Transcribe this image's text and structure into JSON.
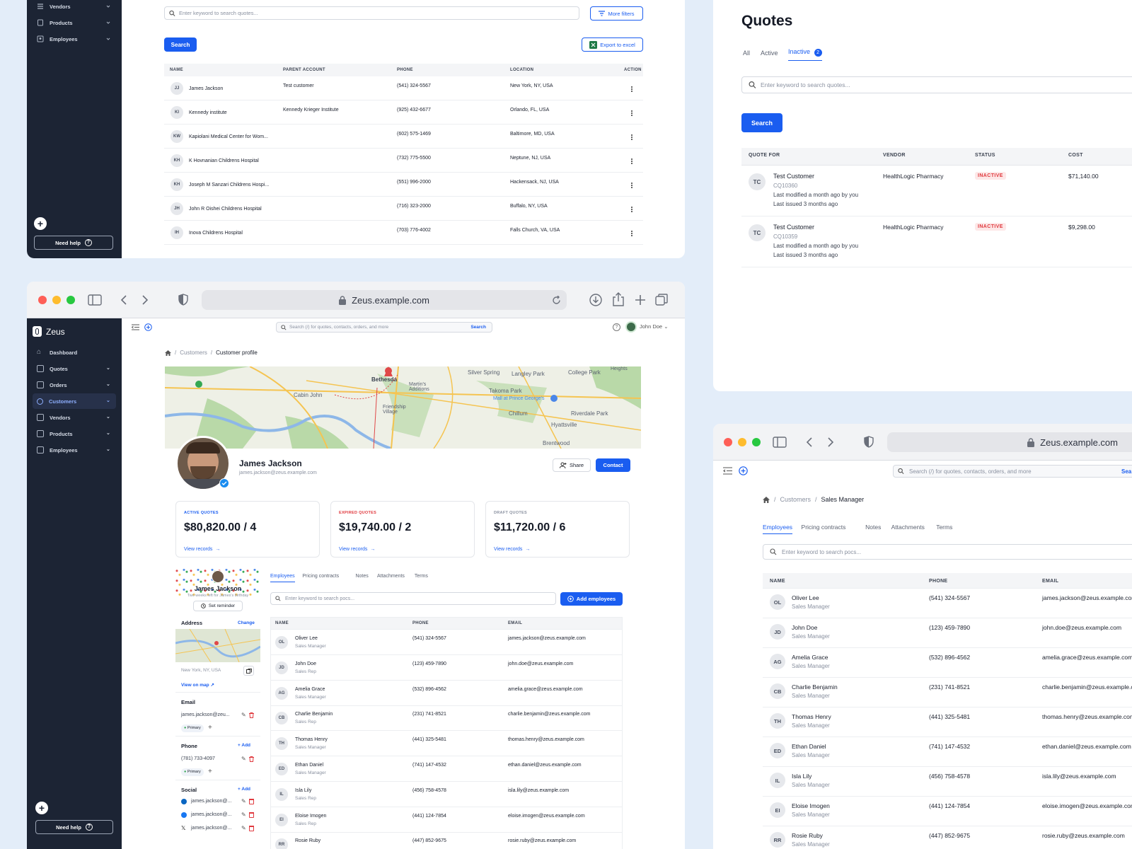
{
  "sidebar_top": {
    "items": [
      {
        "label": "Vendors"
      },
      {
        "label": "Products"
      },
      {
        "label": "Employees"
      }
    ],
    "need_help": "Need help"
  },
  "accounts_panel": {
    "search_placeholder": "Enter keyword to search quotes...",
    "more_filters": "More filters",
    "search_button": "Search",
    "export_button": "Export to excel",
    "columns": [
      "NAME",
      "PARENT ACCOUNT",
      "PHONE",
      "LOCATION",
      "ACTION"
    ],
    "rows": [
      {
        "initials": "JJ",
        "name": "James Jackson",
        "parent": "Test customer",
        "phone": "(541) 324-5567",
        "location": "New York, NY, USA"
      },
      {
        "initials": "KI",
        "name": "Kennedy institute",
        "parent": "Kennedy Krieger Institute",
        "phone": "(925) 432-6677",
        "location": "Orlando, FL, USA"
      },
      {
        "initials": "KW",
        "name": "Kapiolani Medical Center for Wom...",
        "parent": "",
        "phone": "(602) 575-1469",
        "location": "Baltimore, MD, USA"
      },
      {
        "initials": "KH",
        "name": "K Hovnanian Childrens Hospital",
        "parent": "",
        "phone": "(732) 775-5500",
        "location": "Neptune, NJ, USA"
      },
      {
        "initials": "KH",
        "name": "Joseph M Sanzari Childrens Hospi...",
        "parent": "",
        "phone": "(551) 996-2000",
        "location": "Hackensack, NJ, USA"
      },
      {
        "initials": "JH",
        "name": "John R Oishei Childrens Hospital",
        "parent": "",
        "phone": "(716) 323-2000",
        "location": "Buffalo, NY, USA"
      },
      {
        "initials": "IH",
        "name": "Inova Childrens Hospital",
        "parent": "",
        "phone": "(703) 776-4002",
        "location": "Falls Church, VA, USA"
      }
    ]
  },
  "quotes_panel": {
    "title": "Quotes",
    "tabs": [
      {
        "label": "All"
      },
      {
        "label": "Active"
      },
      {
        "label": "Inactive"
      }
    ],
    "inactive_count": "2",
    "search_placeholder": "Enter keyword to search quotes...",
    "search_button": "Search",
    "columns": [
      "QUOTE FOR",
      "VENDOR",
      "STATUS",
      "COST"
    ],
    "rows": [
      {
        "initials": "TC",
        "name": "Test Customer",
        "id": "CQ10360",
        "modified": "Last modified a month ago by you",
        "issued": "Last issued 3 months ago",
        "vendor": "HealthLogic Pharmacy",
        "status": "INACTIVE",
        "cost": "$71,140.00"
      },
      {
        "initials": "TC",
        "name": "Test Customer",
        "id": "CQ10359",
        "modified": "Last modified a month ago by you",
        "issued": "Last issued 3 months ago",
        "vendor": "HealthLogic Pharmacy",
        "status": "INACTIVE",
        "cost": "$9,298.00"
      }
    ]
  },
  "profile_window": {
    "url": "Zeus.example.com",
    "app_name": "Zeus",
    "nav": [
      {
        "label": "Dashboard"
      },
      {
        "label": "Quotes"
      },
      {
        "label": "Orders"
      },
      {
        "label": "Customers"
      },
      {
        "label": "Vendors"
      },
      {
        "label": "Products"
      },
      {
        "label": "Employees"
      }
    ],
    "need_help": "Need help",
    "global_search_placeholder": "Search (/) for quotes, contacts, orders, and more",
    "global_search_button": "Search",
    "user_name": "John Doe",
    "breadcrumb": [
      "Customers",
      "Customer profile"
    ],
    "map_labels": {
      "silver_spring": "Silver Spring",
      "langley_park": "Langley Park",
      "college_park": "College Park",
      "bethesda": "Bethesda",
      "takoma_park": "Takoma Park",
      "cabin_john": "Cabin John",
      "chillum": "Chillum",
      "riverdale_park": "Riverdale Park",
      "hyattsville": "Hyattsville",
      "friendship_village": "Friendship Village",
      "brentwood": "Brentwood",
      "mall_prince_george": "Mall at Prince George's",
      "heights": "Heights",
      "martins_additions": "Martin's Additions"
    },
    "profile_name": "James Jackson",
    "profile_email": "james.jackson@zeus.example.com",
    "share_button": "Share",
    "contact_button": "Contact",
    "stats": [
      {
        "label": "ACTIVE QUOTES",
        "value": "$80,820.00 / 4",
        "link": "View records",
        "color": "#1a5df0"
      },
      {
        "label": "EXPIRED QUOTES",
        "value": "$19,740.00 / 2",
        "link": "View records",
        "color": "#e0393e"
      },
      {
        "label": "DRAFT QUOTES",
        "value": "$11,720.00 / 6",
        "link": "View records",
        "color": "#8a91a0"
      }
    ],
    "card": {
      "name": "James Jackson",
      "birthday": "Two weeks left for James's birthday",
      "set_reminder": "Set reminder",
      "address_label": "Address",
      "change": "Change",
      "address": "New York, NY, USA",
      "view_on_map": "View on map",
      "email_label": "Email",
      "email": "james.jackson@zeu...",
      "primary": "Primary",
      "phone_label": "Phone",
      "add": "Add",
      "phone": "(781) 733-4097",
      "social_label": "Social",
      "socials": [
        "james.jackson@...",
        "james.jackson@...",
        "james.jackson@..."
      ]
    },
    "tabs": [
      {
        "label": "Employees"
      },
      {
        "label": "Pricing contracts"
      },
      {
        "label": "Notes"
      },
      {
        "label": "Attachments"
      },
      {
        "label": "Terms"
      }
    ],
    "emp_search_placeholder": "Enter keyword to search pocs...",
    "add_employees": "Add employees",
    "columns": [
      "NAME",
      "PHONE",
      "EMAIL"
    ],
    "employees": [
      {
        "initials": "OL",
        "name": "Oliver Lee",
        "role": "Sales Manager",
        "phone": "(541) 324-5567",
        "email": "james.jackson@zeus.example.com"
      },
      {
        "initials": "JD",
        "name": "John Doe",
        "role": "Sales Rep",
        "phone": "(123) 459-7890",
        "email": "john.doe@zeus.example.com"
      },
      {
        "initials": "AG",
        "name": "Amelia Grace",
        "role": "Sales Manager",
        "phone": "(532) 896-4562",
        "email": "amelia.grace@zeus.example.com"
      },
      {
        "initials": "CB",
        "name": "Charlie Benjamin",
        "role": "Sales Rep",
        "phone": "(231) 741-8521",
        "email": "charlie.benjamin@zeus.example.com"
      },
      {
        "initials": "TH",
        "name": "Thomas Henry",
        "role": "Sales Manager",
        "phone": "(441) 325-5481",
        "email": "thomas.henry@zeus.example.com"
      },
      {
        "initials": "ED",
        "name": "Ethan Daniel",
        "role": "Sales Manager",
        "phone": "(741) 147-4532",
        "email": "ethan.daniel@zeus.example.com"
      },
      {
        "initials": "IL",
        "name": "Isla Lily",
        "role": "Sales Rep",
        "phone": "(456) 758-4578",
        "email": "isla.lily@zeus.example.com"
      },
      {
        "initials": "EI",
        "name": "Eloise Imogen",
        "role": "Sales Rep",
        "phone": "(441) 124-7854",
        "email": "eloise.imogen@zeus.example.com"
      },
      {
        "initials": "RR",
        "name": "Rosie Ruby",
        "role": "",
        "phone": "(447) 852-9675",
        "email": "rosie.ruby@zeus.example.com"
      }
    ]
  },
  "sales_window": {
    "url": "Zeus.example.com",
    "global_search_placeholder": "Search (/) for quotes, contacts, orders, and more",
    "global_search_button": "Sea",
    "breadcrumb": [
      "Customers",
      "Sales Manager"
    ],
    "tabs": [
      {
        "label": "Employees"
      },
      {
        "label": "Pricing contracts"
      },
      {
        "label": "Notes"
      },
      {
        "label": "Attachments"
      },
      {
        "label": "Terms"
      }
    ],
    "search_placeholder": "Enter keyword to search pocs...",
    "columns": [
      "NAME",
      "PHONE",
      "EMAIL"
    ],
    "employees": [
      {
        "initials": "OL",
        "name": "Oliver Lee",
        "role": "Sales Manager",
        "phone": "(541) 324-5567",
        "email": "james.jackson@zeus.example.com"
      },
      {
        "initials": "JD",
        "name": "John Doe",
        "role": "Sales Manager",
        "phone": "(123) 459-7890",
        "email": "john.doe@zeus.example.com"
      },
      {
        "initials": "AG",
        "name": "Amelia Grace",
        "role": "Sales Manager",
        "phone": "(532) 896-4562",
        "email": "amelia.grace@zeus.example.com"
      },
      {
        "initials": "CB",
        "name": "Charlie Benjamin",
        "role": "Sales Manager",
        "phone": "(231) 741-8521",
        "email": "charlie.benjamin@zeus.example.c"
      },
      {
        "initials": "TH",
        "name": "Thomas Henry",
        "role": "Sales Manager",
        "phone": "(441) 325-5481",
        "email": "thomas.henry@zeus.example.com"
      },
      {
        "initials": "ED",
        "name": "Ethan Daniel",
        "role": "Sales Manager",
        "phone": "(741) 147-4532",
        "email": "ethan.daniel@zeus.example.com"
      },
      {
        "initials": "IL",
        "name": "Isla Lily",
        "role": "Sales Manager",
        "phone": "(456) 758-4578",
        "email": "isla.lily@zeus.example.com"
      },
      {
        "initials": "EI",
        "name": "Eloise Imogen",
        "role": "Sales Manager",
        "phone": "(441) 124-7854",
        "email": "eloise.imogen@zeus.example.com"
      },
      {
        "initials": "RR",
        "name": "Rosie Ruby",
        "role": "Sales Manager",
        "phone": "(447) 852-9675",
        "email": "rosie.ruby@zeus.example.com"
      }
    ]
  },
  "colors": {
    "accent": "#1a5df0",
    "sidebar": "#1c2434",
    "danger": "#e0393e",
    "background": "#e3edf9"
  }
}
